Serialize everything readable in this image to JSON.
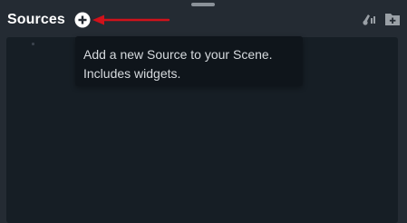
{
  "panel": {
    "title": "Sources",
    "add_button": {
      "icon": "plus-circle-icon"
    },
    "toolbar_icons": [
      "audio-filters-icon",
      "add-folder-icon"
    ],
    "annotation_arrow": {
      "icon": "red-arrow-icon",
      "color": "#d0121b"
    }
  },
  "tooltip": {
    "line1": "Add a new Source to your Scene.",
    "line2": "Includes widgets."
  },
  "colors": {
    "background": "#242b33",
    "list_background": "#161e25",
    "tooltip_background": "#0f151b",
    "text": "#ffffff",
    "icon_muted": "#9aa0a6"
  }
}
